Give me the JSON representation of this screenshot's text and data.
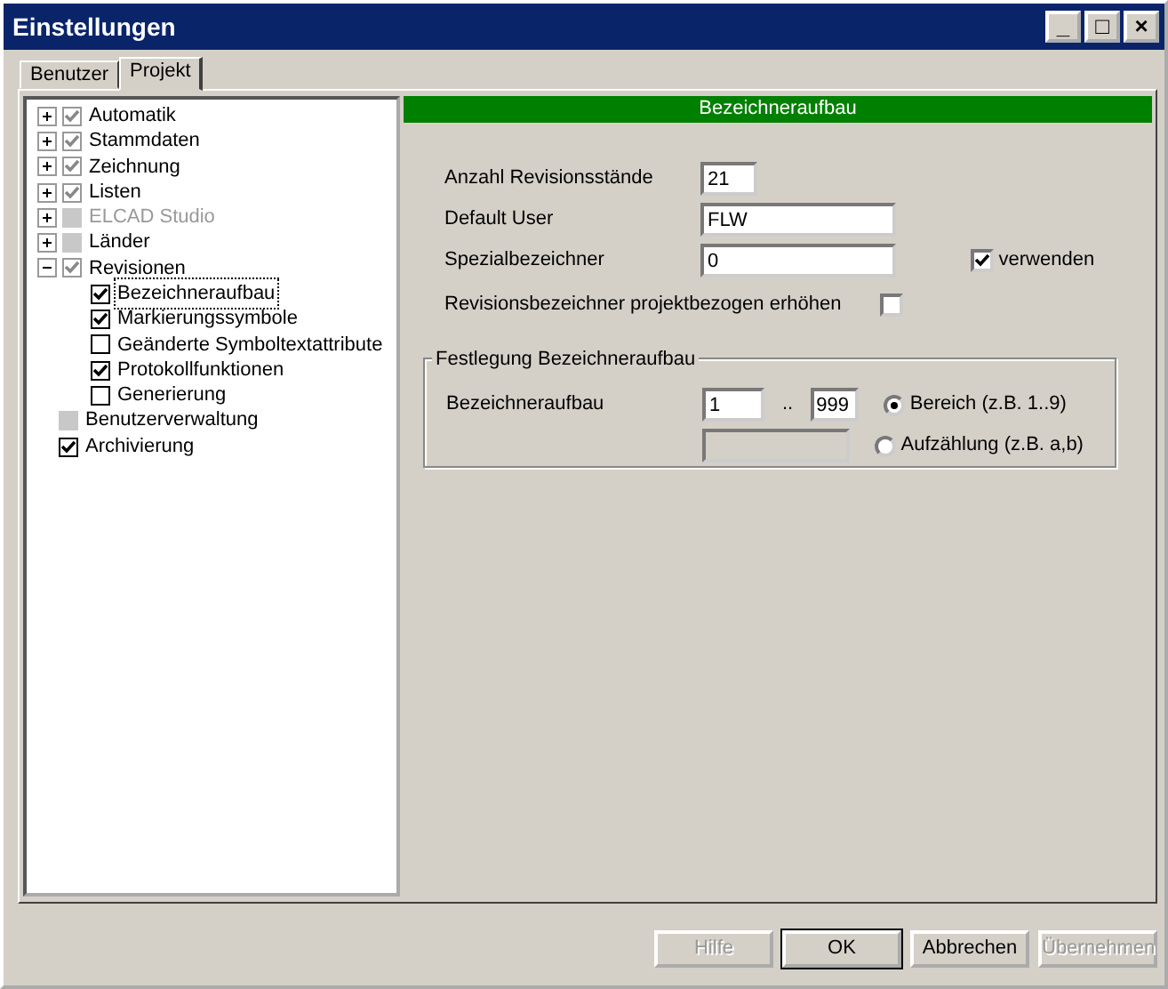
{
  "window": {
    "title": "Einstellungen",
    "controls": [
      "_",
      "□",
      "×"
    ]
  },
  "tabs": [
    {
      "label": "Benutzer",
      "selected": false
    },
    {
      "label": "Projekt",
      "selected": true
    }
  ],
  "tree": [
    {
      "label": "Automatik",
      "kind": "dim",
      "checked": true,
      "expanded": false,
      "disabled": false,
      "selected": false
    },
    {
      "label": "Stammdaten",
      "kind": "dim",
      "checked": true,
      "expanded": false,
      "disabled": false,
      "selected": false
    },
    {
      "label": "Zeichnung",
      "kind": "dim",
      "checked": true,
      "expanded": false,
      "disabled": false,
      "selected": false
    },
    {
      "label": "Listen",
      "kind": "dim",
      "checked": true,
      "expanded": false,
      "disabled": false,
      "selected": false
    },
    {
      "label": "ELCAD Studio",
      "kind": "dim",
      "checked": false,
      "indeterminate": true,
      "expanded": false,
      "disabled": true,
      "selected": false
    },
    {
      "label": "Länder",
      "kind": "dim",
      "checked": false,
      "indeterminate": true,
      "expanded": false,
      "disabled": false,
      "selected": false
    },
    {
      "label": "Revisionen",
      "kind": "dim",
      "checked": true,
      "expanded": true,
      "disabled": false,
      "selected": false,
      "children": [
        {
          "label": "Bezeichneraufbau",
          "kind": "check",
          "checked": true,
          "disabled": false,
          "selected": true
        },
        {
          "label": "Markierungssymbole",
          "kind": "check",
          "checked": true,
          "disabled": false,
          "selected": false
        },
        {
          "label": "Geänderte Symboltextattribute",
          "kind": "check",
          "checked": false,
          "disabled": false,
          "selected": false
        },
        {
          "label": "Protokollfunktionen",
          "kind": "check",
          "checked": true,
          "disabled": false,
          "selected": false
        },
        {
          "label": "Generierung",
          "kind": "check",
          "checked": false,
          "disabled": false,
          "selected": false
        }
      ]
    },
    {
      "label": "Benutzerverwaltung",
      "kind": "dim",
      "checked": false,
      "indeterminate": true,
      "disabled": false,
      "selected": false
    },
    {
      "label": "Archivierung",
      "kind": "check",
      "checked": true,
      "disabled": false,
      "selected": false
    }
  ],
  "panel": {
    "header": "Bezeichneraufbau",
    "fields": [
      {
        "label": "Anzahl Revisionsstände",
        "value": "21",
        "kind": "short"
      },
      {
        "label": "Default User",
        "value": "FLW",
        "kind": "long"
      },
      {
        "label": "Spezialbezeichner",
        "value": "0",
        "kind": "long",
        "option": {
          "label": "verwenden",
          "checked": true
        }
      }
    ],
    "toggle": {
      "label": "Revisionsbezeichner projektbezogen erhöhen",
      "checked": false
    },
    "group": {
      "title": "Festlegung Bezeichneraufbau",
      "label": "Bezeichneraufbau",
      "from": "1",
      "separator": "..",
      "to": "999",
      "radios": [
        {
          "label": "Bereich (z.B. 1..9)",
          "selected": true
        },
        {
          "label": "Aufzählung (z.B. a,b)",
          "selected": false
        }
      ]
    }
  },
  "buttons": [
    {
      "label": "Hilfe",
      "disabled": true,
      "default": false
    },
    {
      "label": "OK",
      "disabled": false,
      "default": true
    },
    {
      "label": "Abbrechen",
      "disabled": false,
      "default": false
    },
    {
      "label": "Übernehmen",
      "disabled": true,
      "default": false
    }
  ]
}
